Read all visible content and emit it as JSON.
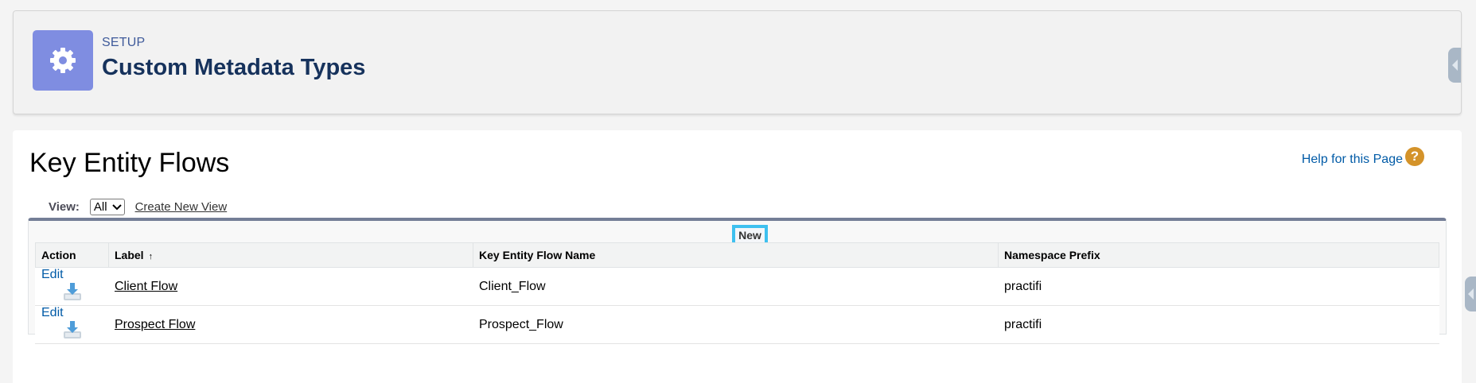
{
  "header": {
    "section_label": "SETUP",
    "title": "Custom Metadata Types",
    "icon": "gear-icon"
  },
  "main": {
    "title": "Key Entity Flows",
    "help_link": "Help for this Page",
    "help_icon": "question-icon",
    "view_label": "View:",
    "view_selected": "All",
    "create_view_link": "Create New View",
    "new_button": "New"
  },
  "table": {
    "columns": [
      "Action",
      "Label",
      "Key Entity Flow Name",
      "Namespace Prefix"
    ],
    "sort_indicator": "↑",
    "rows": [
      {
        "action": "Edit",
        "label": "Client Flow",
        "name": "Client_Flow",
        "prefix": "practifi"
      },
      {
        "action": "Edit",
        "label": "Prospect Flow",
        "name": "Prospect_Flow",
        "prefix": "practifi"
      }
    ]
  },
  "colors": {
    "setup_tile": "#7f8de1",
    "link": "#015ba7",
    "focus_outline": "#3ec0ef",
    "list_top_border": "#747e96"
  }
}
